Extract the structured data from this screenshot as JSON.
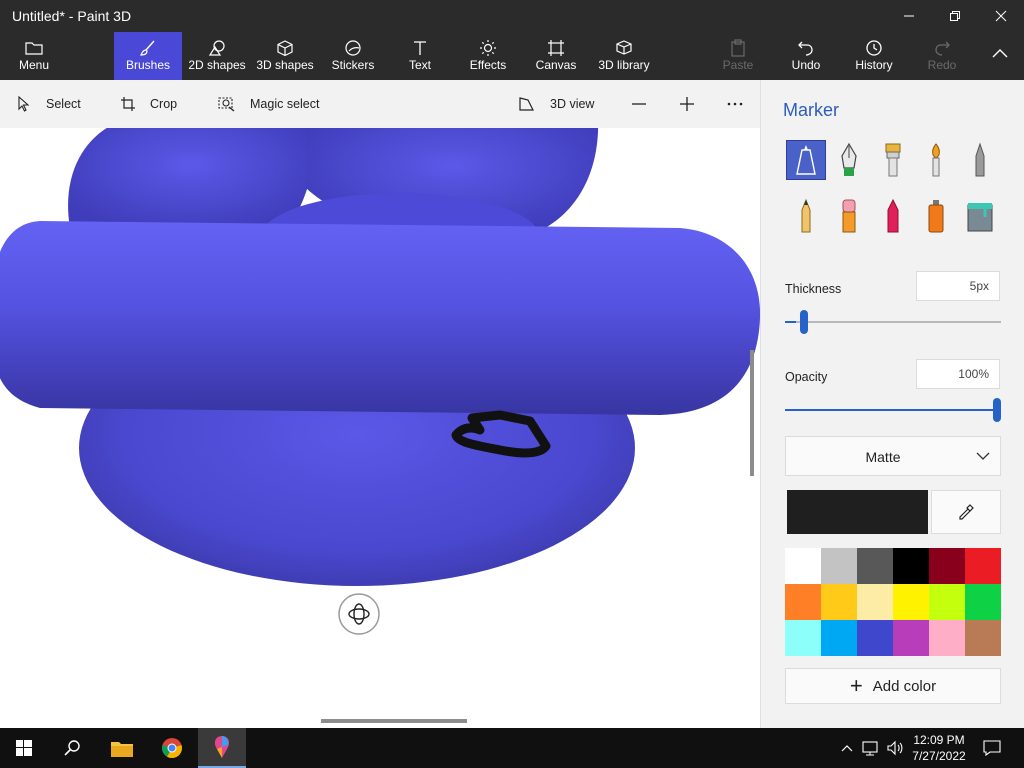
{
  "window": {
    "title": "Untitled* - Paint 3D"
  },
  "ribbon": {
    "menu": "Menu",
    "brushes": "Brushes",
    "shapes2d": "2D shapes",
    "shapes3d": "3D shapes",
    "stickers": "Stickers",
    "text": "Text",
    "effects": "Effects",
    "canvas": "Canvas",
    "library3d": "3D library",
    "paste": "Paste",
    "undo": "Undo",
    "history": "History",
    "redo": "Redo"
  },
  "toolbar": {
    "select": "Select",
    "crop": "Crop",
    "magic_select": "Magic select",
    "view3d": "3D view"
  },
  "panel": {
    "title": "Marker",
    "thickness_label": "Thickness",
    "thickness_value": "5px",
    "thickness_level": 0.05,
    "opacity_label": "Opacity",
    "opacity_value": "100%",
    "opacity_level": 1.0,
    "finish": "Matte",
    "current_color": "#1f1f1f",
    "add_color": "Add color",
    "brushes": [
      "marker",
      "calligraphy-pen",
      "oil-brush",
      "watercolor",
      "pixel-pen",
      "pencil",
      "eraser",
      "crayon",
      "spray-can",
      "fill"
    ],
    "palette": [
      "#ffffff",
      "#c3c3c3",
      "#585858",
      "#000000",
      "#88001b",
      "#ec1c24",
      "#ff7f27",
      "#ffca18",
      "#fdeca6",
      "#fff200",
      "#c4ff0e",
      "#0ed145",
      "#8cfffb",
      "#00a8f3",
      "#3f48cc",
      "#b83dba",
      "#ffaec8",
      "#b97a56"
    ]
  },
  "taskbar": {
    "time": "12:09 PM",
    "date": "7/27/2022"
  }
}
